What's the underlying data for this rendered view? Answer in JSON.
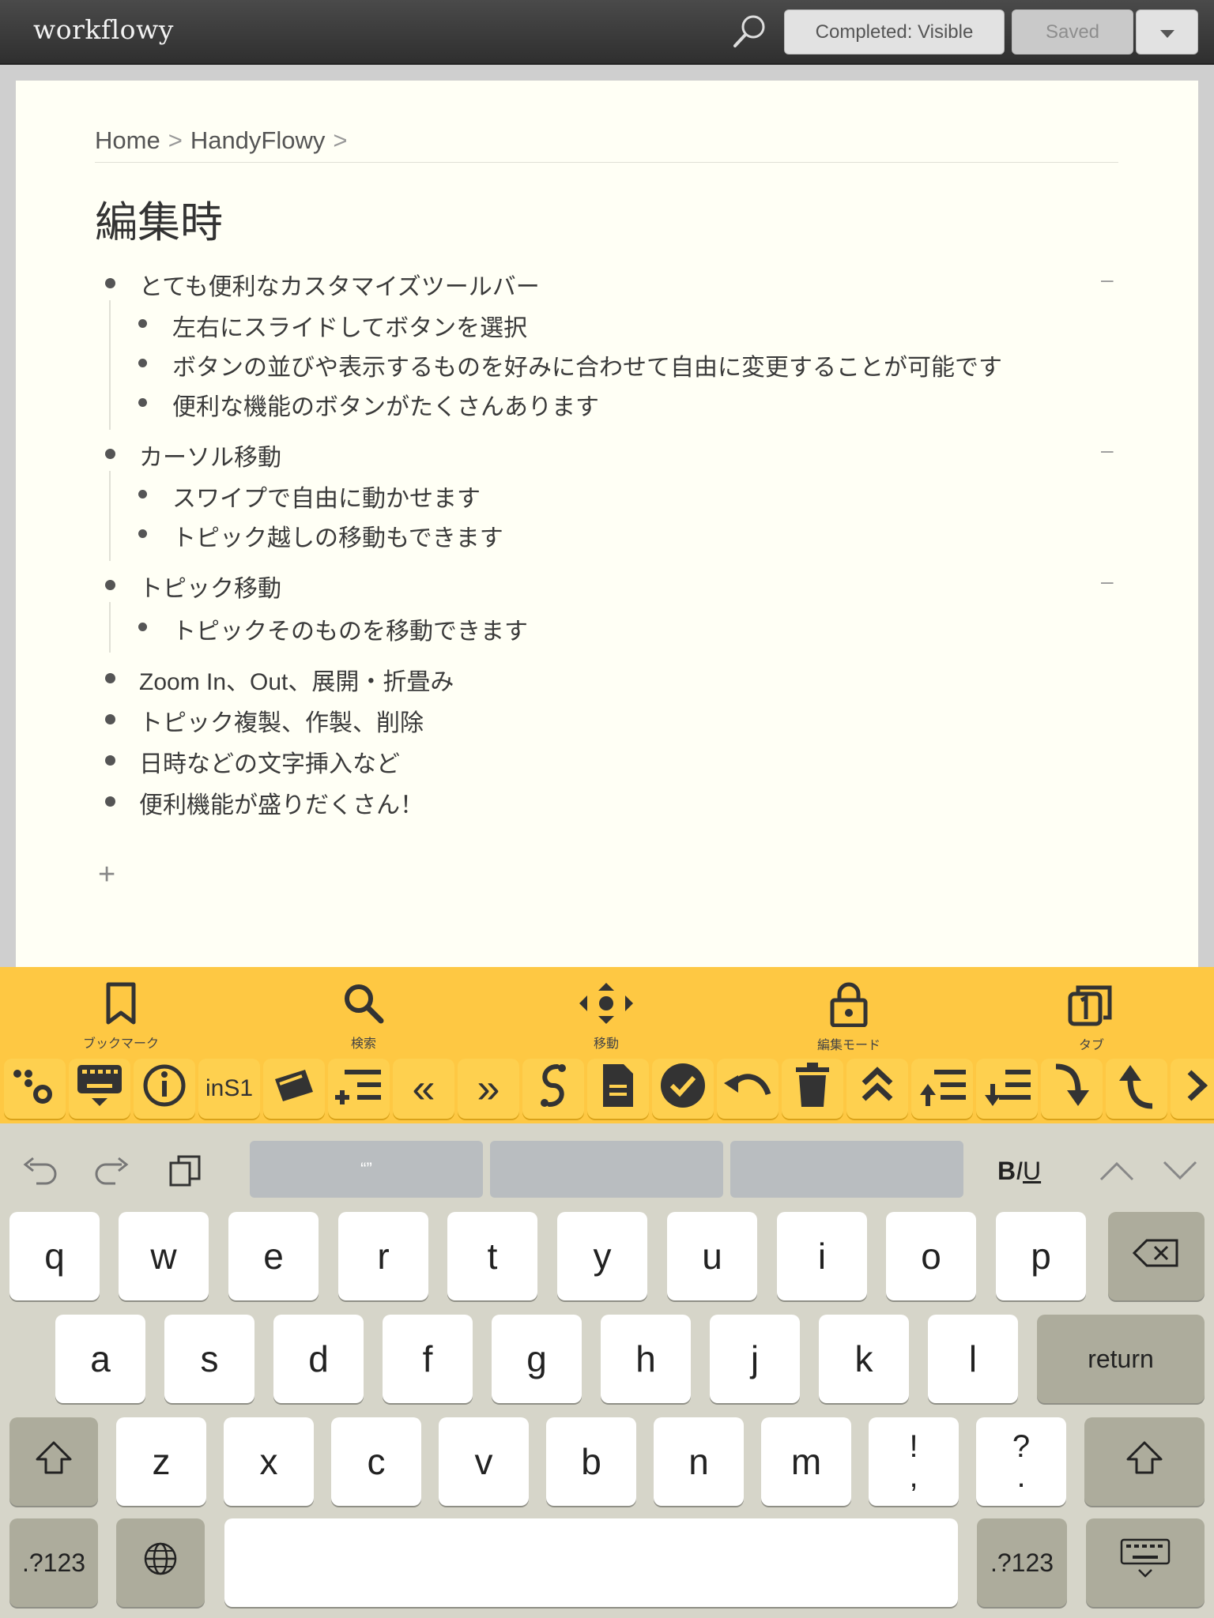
{
  "topbar": {
    "logo": "workflowy",
    "completed_label": "Completed: Visible",
    "saved_label": "Saved",
    "search_icon": "search-icon",
    "dropdown_icon": "caret-down-icon"
  },
  "breadcrumb": {
    "home": "Home",
    "sep1": ">",
    "parent": "HandyFlowy",
    "sep2": ">"
  },
  "page": {
    "title": "編集時",
    "items": [
      {
        "text": "とても便利なカスタマイズツールバー",
        "collapse": "–",
        "children": [
          "左右にスライドしてボタンを選択",
          "ボタンの並びや表示するものを好みに合わせて自由に変更することが可能です",
          "便利な機能のボタンがたくさんあります"
        ]
      },
      {
        "text": "カーソル移動",
        "collapse": "–",
        "children": [
          "スワイプで自由に動かせます",
          "トピック越しの移動もできます"
        ]
      },
      {
        "text": "トピック移動",
        "collapse": "–",
        "children": [
          "トピックそのものを移動できます"
        ]
      },
      {
        "text": "Zoom In、Out、展開・折畳み"
      },
      {
        "text": "トピック複製、作製、削除"
      },
      {
        "text": "日時などの文字挿入など"
      },
      {
        "text": "便利機能が盛りだくさん！"
      }
    ],
    "add": "+"
  },
  "toolbar1": [
    {
      "label": "ブックマーク",
      "icon": "bookmark-icon"
    },
    {
      "label": "検索",
      "icon": "search-icon"
    },
    {
      "label": "移動",
      "icon": "move-icon"
    },
    {
      "label": "編集モード",
      "icon": "lock-icon"
    },
    {
      "label": "タブ",
      "icon": "tabs-icon"
    }
  ],
  "toolbar2": {
    "ins_label": "inS1",
    "icons": [
      "settings-dots-icon",
      "keyboard-hide-icon",
      "info-icon",
      "ins1-button",
      "cards-icon",
      "add-line-icon",
      "double-left-icon",
      "double-right-icon",
      "link-icon",
      "document-icon",
      "check-icon",
      "undo-icon",
      "trash-icon",
      "double-up-icon",
      "indent-up-icon",
      "indent-down-icon",
      "arrow-down-right-icon",
      "arrow-up-left-icon",
      "next-icon"
    ]
  },
  "keyboard": {
    "quote_label": "“”",
    "biu": {
      "b": "B",
      "i": "I",
      "u": "U"
    },
    "row1": [
      "q",
      "w",
      "e",
      "r",
      "t",
      "y",
      "u",
      "i",
      "o",
      "p"
    ],
    "row2": [
      "a",
      "s",
      "d",
      "f",
      "g",
      "h",
      "j",
      "k",
      "l"
    ],
    "row3": [
      "z",
      "x",
      "c",
      "v",
      "b",
      "n",
      "m"
    ],
    "excl": [
      "!",
      ","
    ],
    "quest": [
      "?",
      "."
    ],
    "return_label": "return",
    "num_label": ".?123",
    "num_label_right": ".?123"
  },
  "colors": {
    "toolbar": "#fec843",
    "page_bg": "#fffff5",
    "topbar": "#3a3a3a"
  }
}
